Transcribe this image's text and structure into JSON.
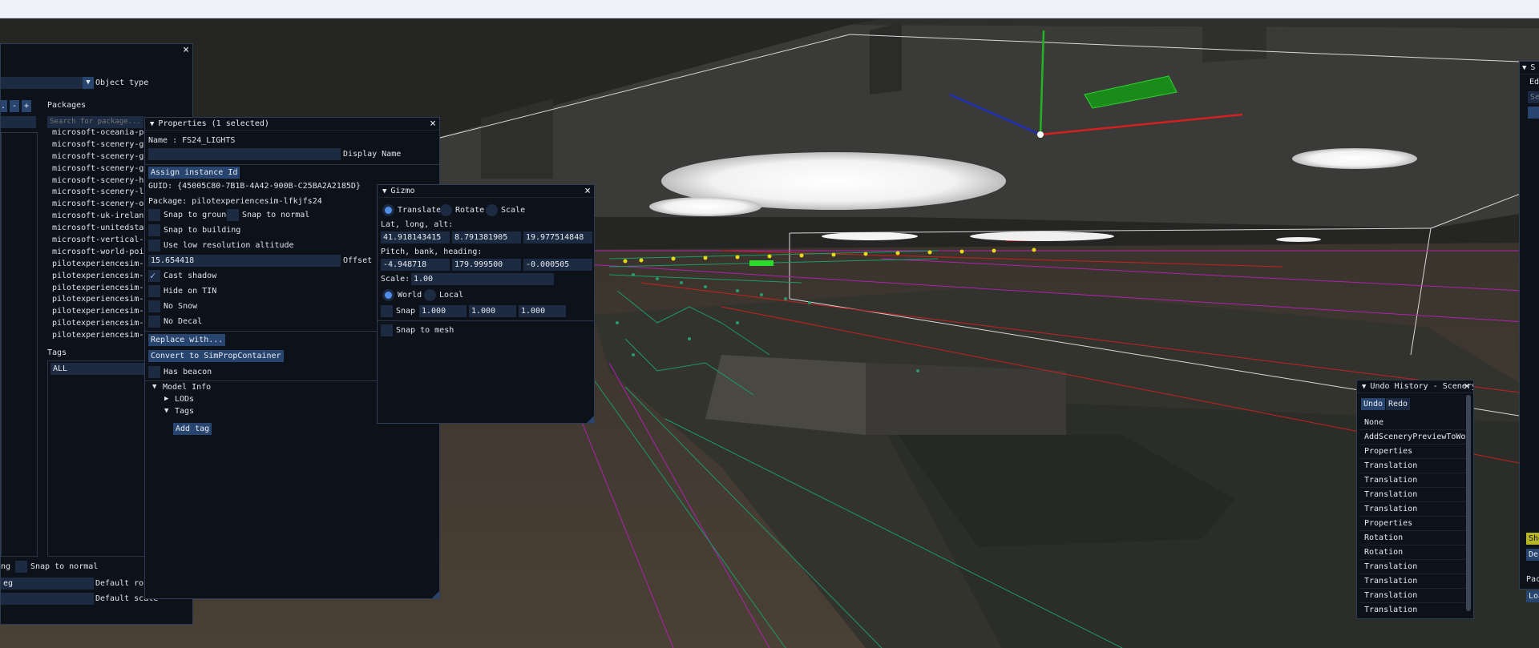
{
  "app": {
    "top_bar": ""
  },
  "object_panel": {
    "object_type_label": "Object type",
    "packages_label": "Packages",
    "search_placeholder": "Search for package...",
    "packages": [
      "microsoft-oceania-poi",
      "microsoft-scenery-gli",
      "microsoft-scenery-gli",
      "microsoft-scenery-gran",
      "microsoft-scenery-hel",
      "microsoft-scenery-lasv",
      "microsoft-scenery-oil",
      "microsoft-uk-ireland-p",
      "microsoft-unitedstates",
      "microsoft-vertical-obs",
      "microsoft-world-point-",
      "pilotexperiencesim-lfk",
      "pilotexperiencesim-lfk",
      "pilotexperiencesim-lfk",
      "pilotexperiencesim-lfk",
      "pilotexperiencesim-lfk",
      "pilotexperiencesim-lfk",
      "pilotexperiencesim-lft"
    ],
    "tags_label": "Tags",
    "tags_value": "ALL",
    "snap_left_label": "ng",
    "snap_normal_label": "Snap to normal",
    "rot_value": "eg",
    "default_rotation_label": "Default rota",
    "default_scale_label": "Default scale"
  },
  "properties": {
    "title": "Properties (1 selected)",
    "name_line": "Name : FS24_LIGHTS",
    "display_name_label": "Display Name",
    "display_name_value": "",
    "assign_button": "Assign instance Id",
    "guid": "GUID: {45005C80-7B1B-4A42-900B-C25BA2A2185D}",
    "package_line": "Package: pilotexperiencesim-lfkjfs24",
    "snap_ground": "Snap to ground",
    "snap_normal": "Snap to normal",
    "snap_building": "Snap to building",
    "low_res_alt": "Use low resolution altitude",
    "offset_value": "15.654418",
    "offset_label": "Offset t",
    "cast_shadow": "Cast shadow",
    "hide_tin": "Hide on TIN",
    "no_snow": "No Snow",
    "no_decal": "No Decal",
    "replace_button": "Replace with...",
    "convert_button": "Convert to SimPropContainer",
    "has_beacon": "Has beacon",
    "model_info": "Model Info",
    "lods": "LODs",
    "tags": "Tags",
    "add_tag_button": "Add tag"
  },
  "gizmo": {
    "title": "Gizmo",
    "translate": "Translate",
    "rotate": "Rotate",
    "scale": "Scale",
    "lat_label": "Lat, long, alt:",
    "lat": "41.918143415",
    "long": "8.791381905",
    "alt": "19.977514848",
    "pbh_label": "Pitch, bank, heading:",
    "pitch": "-4.948718",
    "bank": "179.999500",
    "heading": "-0.000505",
    "scale_label": "Scale:",
    "scale_value": "1.00",
    "world": "World",
    "local": "Local",
    "snap": "Snap",
    "snap_x": "1.000",
    "snap_y": "1.000",
    "snap_z": "1.000",
    "snap_mesh": "Snap to mesh"
  },
  "undo_history": {
    "title": "Undo History - Scenery",
    "undo_button": "Undo",
    "redo_button": "Redo",
    "items": [
      "None",
      "AddSceneryPreviewToWorld",
      "Properties",
      "Translation",
      "Translation",
      "Translation",
      "Translation",
      "Properties",
      "Rotation",
      "Rotation",
      "Translation",
      "Translation",
      "Translation",
      "Translation"
    ]
  },
  "right_panel": {
    "title": "S",
    "tab": "Edi",
    "search": "Sea",
    "show_button": "Sho",
    "delete_button": "Del",
    "pack_label": "Pac",
    "load_button": "Loa"
  },
  "scene": {
    "sign_text": "",
    "colors": {
      "axis_x": "#d42020",
      "axis_y": "#21b321",
      "axis_z": "#1f2fb5",
      "panel_bg": "#0d111a",
      "field_bg": "#1c2a42",
      "button_bg": "#27456f",
      "accent_yellow": "#b5b526"
    }
  }
}
